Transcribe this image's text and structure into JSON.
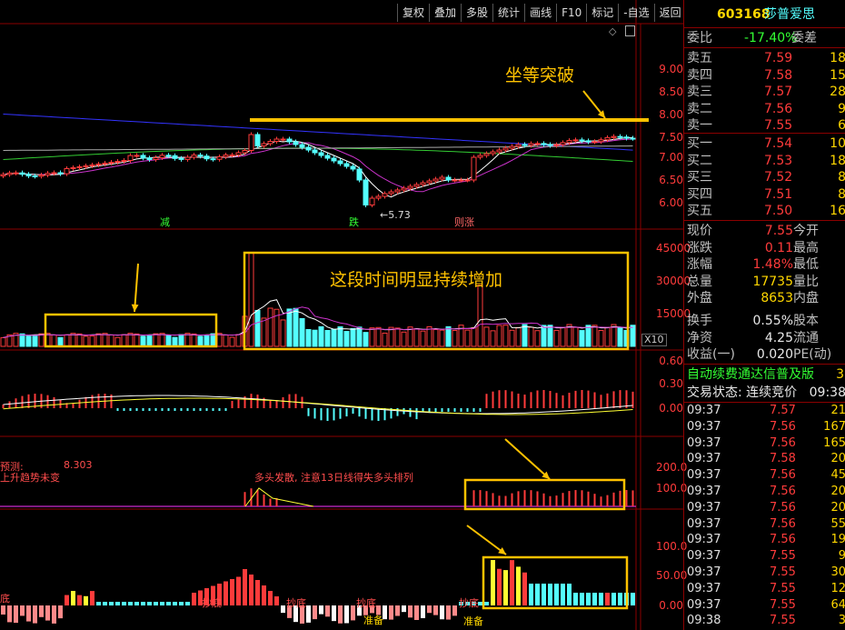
{
  "toolbar": {
    "buttons": [
      "复权",
      "叠加",
      "多股",
      "统计",
      "画线",
      "F10",
      "标记",
      "-自选",
      "返回"
    ]
  },
  "stock": {
    "code": "603168",
    "name": "莎普爱思"
  },
  "quote": {
    "weibi_label": "委比",
    "weibi_value": "-17.40%",
    "weicha_label": "委差",
    "sell": [
      {
        "label": "卖五",
        "price": "7.59",
        "vol": "18"
      },
      {
        "label": "卖四",
        "price": "7.58",
        "vol": "15"
      },
      {
        "label": "卖三",
        "price": "7.57",
        "vol": "28"
      },
      {
        "label": "卖二",
        "price": "7.56",
        "vol": "9"
      },
      {
        "label": "卖一",
        "price": "7.55",
        "vol": "6"
      }
    ],
    "buy": [
      {
        "label": "买一",
        "price": "7.54",
        "vol": "10"
      },
      {
        "label": "买二",
        "price": "7.53",
        "vol": "18"
      },
      {
        "label": "买三",
        "price": "7.52",
        "vol": "8"
      },
      {
        "label": "买四",
        "price": "7.51",
        "vol": "8"
      },
      {
        "label": "买五",
        "price": "7.50",
        "vol": "16"
      }
    ],
    "stats": [
      {
        "l1": "现价",
        "v1": "7.55",
        "l2": "今开"
      },
      {
        "l1": "涨跌",
        "v1": "0.11",
        "l2": "最高"
      },
      {
        "l1": "涨幅",
        "v1": "1.48%",
        "l2": "最低"
      },
      {
        "l1": "总量",
        "v1": "17735",
        "l2": "量比"
      },
      {
        "l1": "外盘",
        "v1": "8653",
        "l2": "内盘"
      },
      {
        "l1": "换手",
        "v1": "0.55%",
        "l2": "股本"
      },
      {
        "l1": "净资",
        "v1": "4.25",
        "l2": "流通"
      },
      {
        "l1": "收益(一)",
        "v1": "0.020",
        "l2": "PE(动)"
      }
    ],
    "banner": "自动续费通达信普及版",
    "banner_tail": "3",
    "trade_state": "交易状态: 连续竞价",
    "trade_time": "09:38"
  },
  "ticks": [
    {
      "time": "09:37",
      "price": "7.57",
      "vol": "21"
    },
    {
      "time": "09:37",
      "price": "7.56",
      "vol": "167"
    },
    {
      "time": "09:37",
      "price": "7.56",
      "vol": "165"
    },
    {
      "time": "09:37",
      "price": "7.58",
      "vol": "20"
    },
    {
      "time": "09:37",
      "price": "7.56",
      "vol": "45"
    },
    {
      "time": "09:37",
      "price": "7.56",
      "vol": "20"
    },
    {
      "time": "09:37",
      "price": "7.56",
      "vol": "20"
    },
    {
      "time": "09:37",
      "price": "7.56",
      "vol": "55"
    },
    {
      "time": "09:37",
      "price": "7.56",
      "vol": "19"
    },
    {
      "time": "09:37",
      "price": "7.55",
      "vol": "9"
    },
    {
      "time": "09:37",
      "price": "7.55",
      "vol": "30"
    },
    {
      "time": "09:37",
      "price": "7.55",
      "vol": "12"
    },
    {
      "time": "09:37",
      "price": "7.55",
      "vol": "64"
    },
    {
      "time": "09:38",
      "price": "7.55",
      "vol": "3"
    }
  ],
  "axes": {
    "price": [
      "9.00",
      "8.50",
      "8.00",
      "7.50",
      "7.00",
      "6.50",
      "6.00"
    ],
    "volume": [
      "45000",
      "30000",
      "15000"
    ],
    "volume_unit": "X10",
    "macd": [
      "0.60",
      "0.30",
      "0.00"
    ],
    "ind3": [
      "200.0",
      "100.0"
    ],
    "ind4": [
      "100.0",
      "50.00",
      "0.00"
    ]
  },
  "chart_labels": {
    "low_marker": "5.73",
    "sig_jian": "减",
    "sig_die": "跌",
    "sig_zhang": "涨",
    "sig_zhang_prefix": "则",
    "ind3_title_left": "预测:",
    "ind3_value": "8.303",
    "ind3_text": "上升趋势未变",
    "ind3_note": "多头发散, 注意13日线得失多头排列",
    "ind4_labels": [
      "底",
      "抄底",
      "抄底",
      "抄底",
      "抄底"
    ],
    "ind4_zhunbei": [
      "准备",
      "准备"
    ]
  },
  "annotations": {
    "breakout": "坐等突破",
    "volume_increase": "这段时间明显持续增加"
  },
  "chart_data": {
    "type": "candlestick",
    "price_ylim": [
      5.6,
      9.3
    ],
    "volume_ylim": [
      0,
      45000
    ],
    "resistance_level": 7.82,
    "low_point": 5.73,
    "last_price": 7.55
  },
  "colors": {
    "up": "#ff3b3b",
    "down": "#54ffff",
    "accent": "#ffc200",
    "ma_blue": "#3333ff",
    "ma_green": "#33cc33"
  }
}
